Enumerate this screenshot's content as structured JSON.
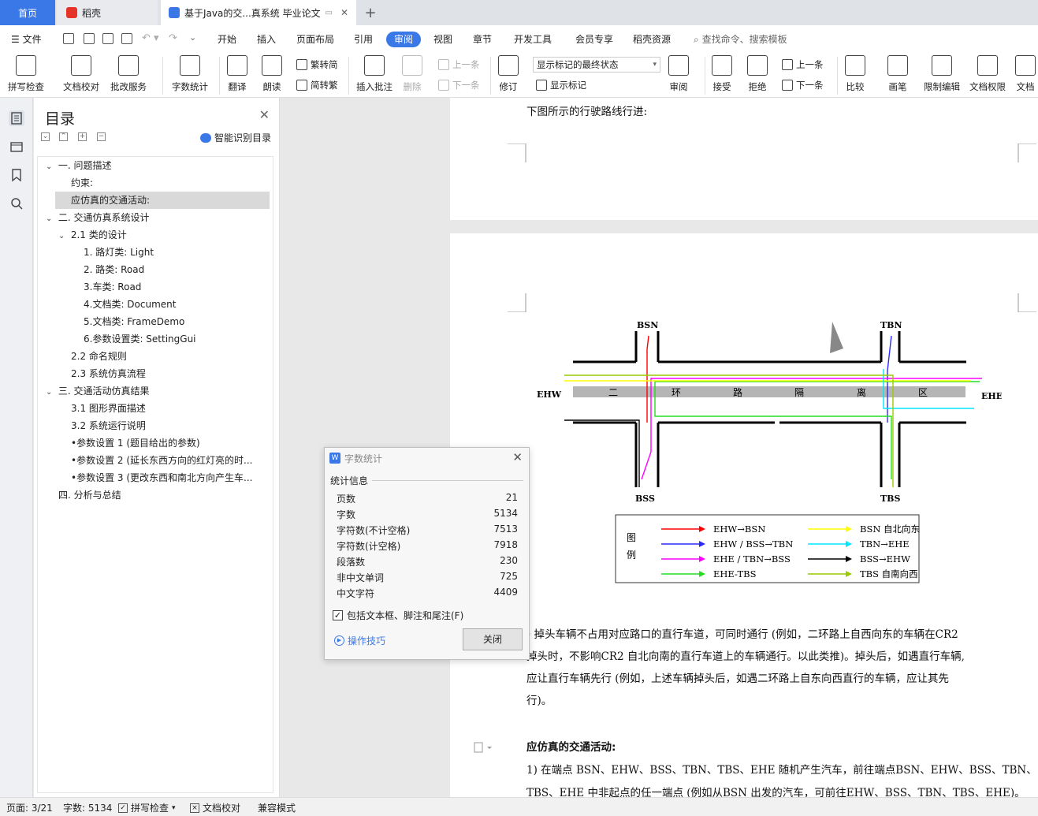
{
  "tabs": {
    "home": "首页",
    "daoke": "稻壳",
    "doc": "基于Java的交...真系统 毕业论文"
  },
  "menu": {
    "file": "文件",
    "items": [
      "开始",
      "插入",
      "页面布局",
      "引用",
      "审阅",
      "视图",
      "章节",
      "开发工具",
      "会员专享",
      "稻壳资源"
    ],
    "search": "查找命令、搜索模板"
  },
  "ribbon": {
    "spellcheck": "拼写检查",
    "doccheck": "文档校对",
    "revise_service": "批改服务",
    "wordcount": "字数统计",
    "translate": "翻译",
    "read": "朗读",
    "trad": "繁转简",
    "simp": "简转繁",
    "insert_comment": "插入批注",
    "delete": "删除",
    "prev": "上一条",
    "next": "下一条",
    "track": "修订",
    "markup_state": "显示标记的最终状态",
    "show_markup": "显示标记",
    "review": "审阅",
    "accept": "接受",
    "reject": "拒绝",
    "prev2": "上一条",
    "next2": "下一条",
    "compare": "比较",
    "pen": "画笔",
    "restrict": "限制编辑",
    "perm": "文档权限",
    "docx": "文档"
  },
  "toc": {
    "title": "目录",
    "smart": "智能识别目录",
    "items": [
      {
        "text": "一. 问题描述"
      },
      {
        "text": "约束:"
      },
      {
        "text": "应仿真的交通活动:"
      },
      {
        "text": "二. 交通仿真系统设计"
      },
      {
        "text": "2.1 类的设计"
      },
      {
        "text": "1. 路灯类: Light"
      },
      {
        "text": "2. 路类: Road"
      },
      {
        "text": "3.车类: Road"
      },
      {
        "text": "4.文档类: Document"
      },
      {
        "text": "5.文档类: FrameDemo"
      },
      {
        "text": "6.参数设置类: SettingGui"
      },
      {
        "text": "2.2 命名规则"
      },
      {
        "text": "2.3 系统仿真流程"
      },
      {
        "text": "三. 交通活动仿真结果"
      },
      {
        "text": "3.1 图形界面描述"
      },
      {
        "text": "3.2 系统运行说明"
      },
      {
        "text": "•参数设置 1 (题目给出的参数)"
      },
      {
        "text": "•参数设置 2 (延长东西方向的红灯亮的时..."
      },
      {
        "text": "•参数设置 3 (更改东西和南北方向产生车..."
      },
      {
        "text": "四. 分析与总结"
      }
    ]
  },
  "document": {
    "p1_text": "下图所示的行驶路线行进:",
    "fig": {
      "bsn": "BSN",
      "tbn": "TBN",
      "ehw": "EHW",
      "ehe": "EHE",
      "bss": "BSS",
      "tbs": "TBS",
      "ring_chars": [
        "二",
        "环",
        "路",
        "隔",
        "离",
        "区"
      ],
      "legend_title": [
        "图",
        "例"
      ],
      "legend": [
        {
          "label": "EHW→BSN",
          "color": "#ff0000"
        },
        {
          "label": "EHW / BSS→TBN",
          "color": "#2a2aff"
        },
        {
          "label": "EHE / TBN→BSS",
          "color": "#ff00ff"
        },
        {
          "label": "EHE-TBS",
          "color": "#22dd22"
        },
        {
          "label": "BSN 自北向东",
          "color": "#ffff00"
        },
        {
          "label": "TBN→EHE",
          "color": "#00e5ff"
        },
        {
          "label": "BSS→EHW",
          "color": "#000000"
        },
        {
          "label": "TBS 自南向西",
          "color": "#99cc00"
        }
      ]
    },
    "para3_l1": ") 掉头车辆不占用对应路口的直行车道，可同时通行 (例如，二环路上自西向东的车辆在CR2",
    "para3_l2": "掉头时，不影响CR2 自北向南的直行车道上的车辆通行。以此类推)。掉头后，如遇直行车辆,",
    "para3_l3": "应让直行车辆先行 (例如，上述车辆掉头后，如遇二环路上自东向西直行的车辆，应让其先",
    "para3_l4": "行)。",
    "heading": "应仿真的交通活动:",
    "para4_l1": "1) 在端点 BSN、EHW、BSS、TBN、TBS、EHE 随机产生汽车，前往端点BSN、EHW、BSS、TBN、",
    "para4_l2": "TBS、EHE 中非起点的任一端点 (例如从BSN 出发的汽车，可前往EHW、BSS、TBN、TBS、EHE)。"
  },
  "dialog": {
    "title": "字数统计",
    "section": "统计信息",
    "stats": [
      {
        "k": "页数",
        "v": "21"
      },
      {
        "k": "字数",
        "v": "5134"
      },
      {
        "k": "字符数(不计空格)",
        "v": "7513"
      },
      {
        "k": "字符数(计空格)",
        "v": "7918"
      },
      {
        "k": "段落数",
        "v": "230"
      },
      {
        "k": "非中文单词",
        "v": "725"
      },
      {
        "k": "中文字符",
        "v": "4409"
      }
    ],
    "checkbox": "包括文本框、脚注和尾注(F)",
    "tips": "操作技巧",
    "close": "关闭"
  },
  "status": {
    "page": "页面: 3/21",
    "words": "字数: 5134",
    "spell": "拼写检查",
    "check": "文档校对",
    "compat": "兼容模式"
  }
}
